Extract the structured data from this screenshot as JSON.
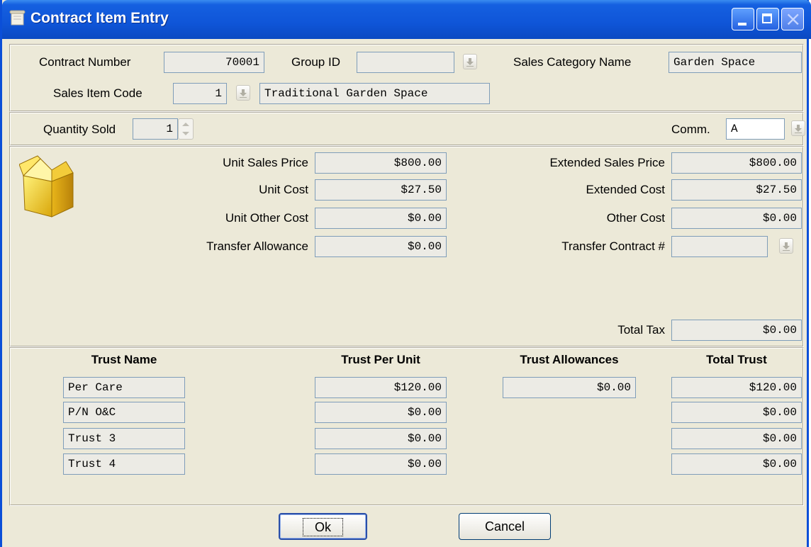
{
  "window": {
    "title": "Contract Item Entry"
  },
  "header": {
    "contract_number_label": "Contract Number",
    "contract_number": "70001",
    "group_id_label": "Group ID",
    "group_id": "",
    "sales_category_label": "Sales Category Name",
    "sales_category": "Garden Space",
    "sales_item_code_label": "Sales Item Code",
    "sales_item_code": "1",
    "sales_item_name": "Traditional Garden Space"
  },
  "quantity": {
    "label": "Quantity Sold",
    "value": "1",
    "comm_label": "Comm.",
    "comm_value": "A"
  },
  "pricing": {
    "unit_sales_price_label": "Unit Sales Price",
    "unit_sales_price": "$800.00",
    "unit_cost_label": "Unit Cost",
    "unit_cost": "$27.50",
    "unit_other_cost_label": "Unit Other Cost",
    "unit_other_cost": "$0.00",
    "transfer_allowance_label": "Transfer Allowance",
    "transfer_allowance": "$0.00",
    "extended_sales_price_label": "Extended Sales Price",
    "extended_sales_price": "$800.00",
    "extended_cost_label": "Extended Cost",
    "extended_cost": "$27.50",
    "other_cost_label": "Other Cost",
    "other_cost": "$0.00",
    "transfer_contract_label": "Transfer Contract #",
    "transfer_contract": "",
    "total_tax_label": "Total Tax",
    "total_tax": "$0.00"
  },
  "trust": {
    "headers": {
      "name": "Trust Name",
      "per_unit": "Trust Per Unit",
      "allowances": "Trust Allowances",
      "total": "Total Trust"
    },
    "rows": [
      {
        "name": "Per Care",
        "per_unit": "$120.00",
        "allowance": "$0.00",
        "total": "$120.00"
      },
      {
        "name": "P/N O&C",
        "per_unit": "$0.00",
        "total": "$0.00"
      },
      {
        "name": "Trust 3",
        "per_unit": "$0.00",
        "total": "$0.00"
      },
      {
        "name": "Trust 4",
        "per_unit": "$0.00",
        "total": "$0.00"
      }
    ]
  },
  "buttons": {
    "ok": "Ok",
    "cancel": "Cancel"
  }
}
